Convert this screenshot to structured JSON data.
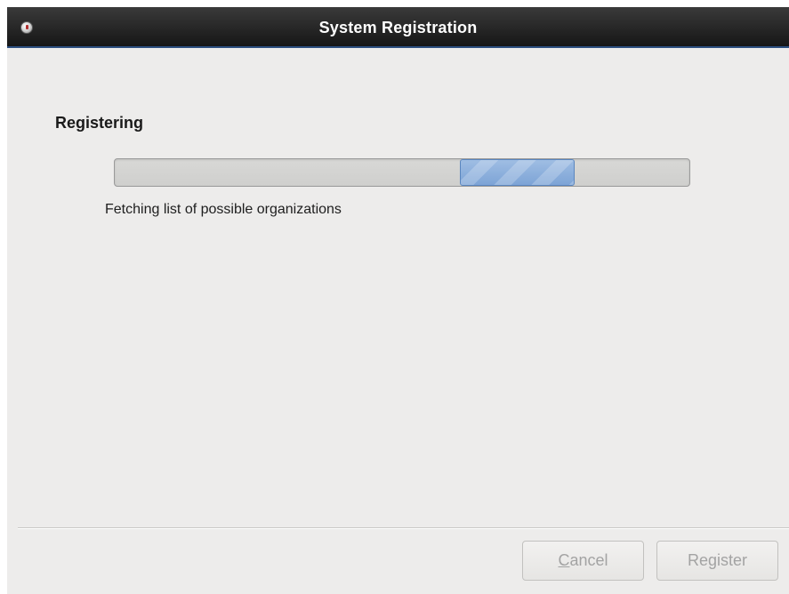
{
  "window": {
    "title": "System Registration",
    "menu_icon": "window-menu-icon"
  },
  "page": {
    "heading": "Registering",
    "status": "Fetching list of possible organizations",
    "progress": {
      "mode": "indeterminate",
      "pulse_start_fraction": 0.6,
      "pulse_end_fraction": 0.8
    }
  },
  "buttons": {
    "cancel": {
      "mnemonic": "C",
      "rest": "ancel",
      "enabled": false
    },
    "register": {
      "label": "Register",
      "enabled": false
    }
  },
  "colors": {
    "titlebar": "#1f1f1f",
    "progress_fill": "#8db0dd",
    "disabled_text": "#a3a3a3"
  }
}
